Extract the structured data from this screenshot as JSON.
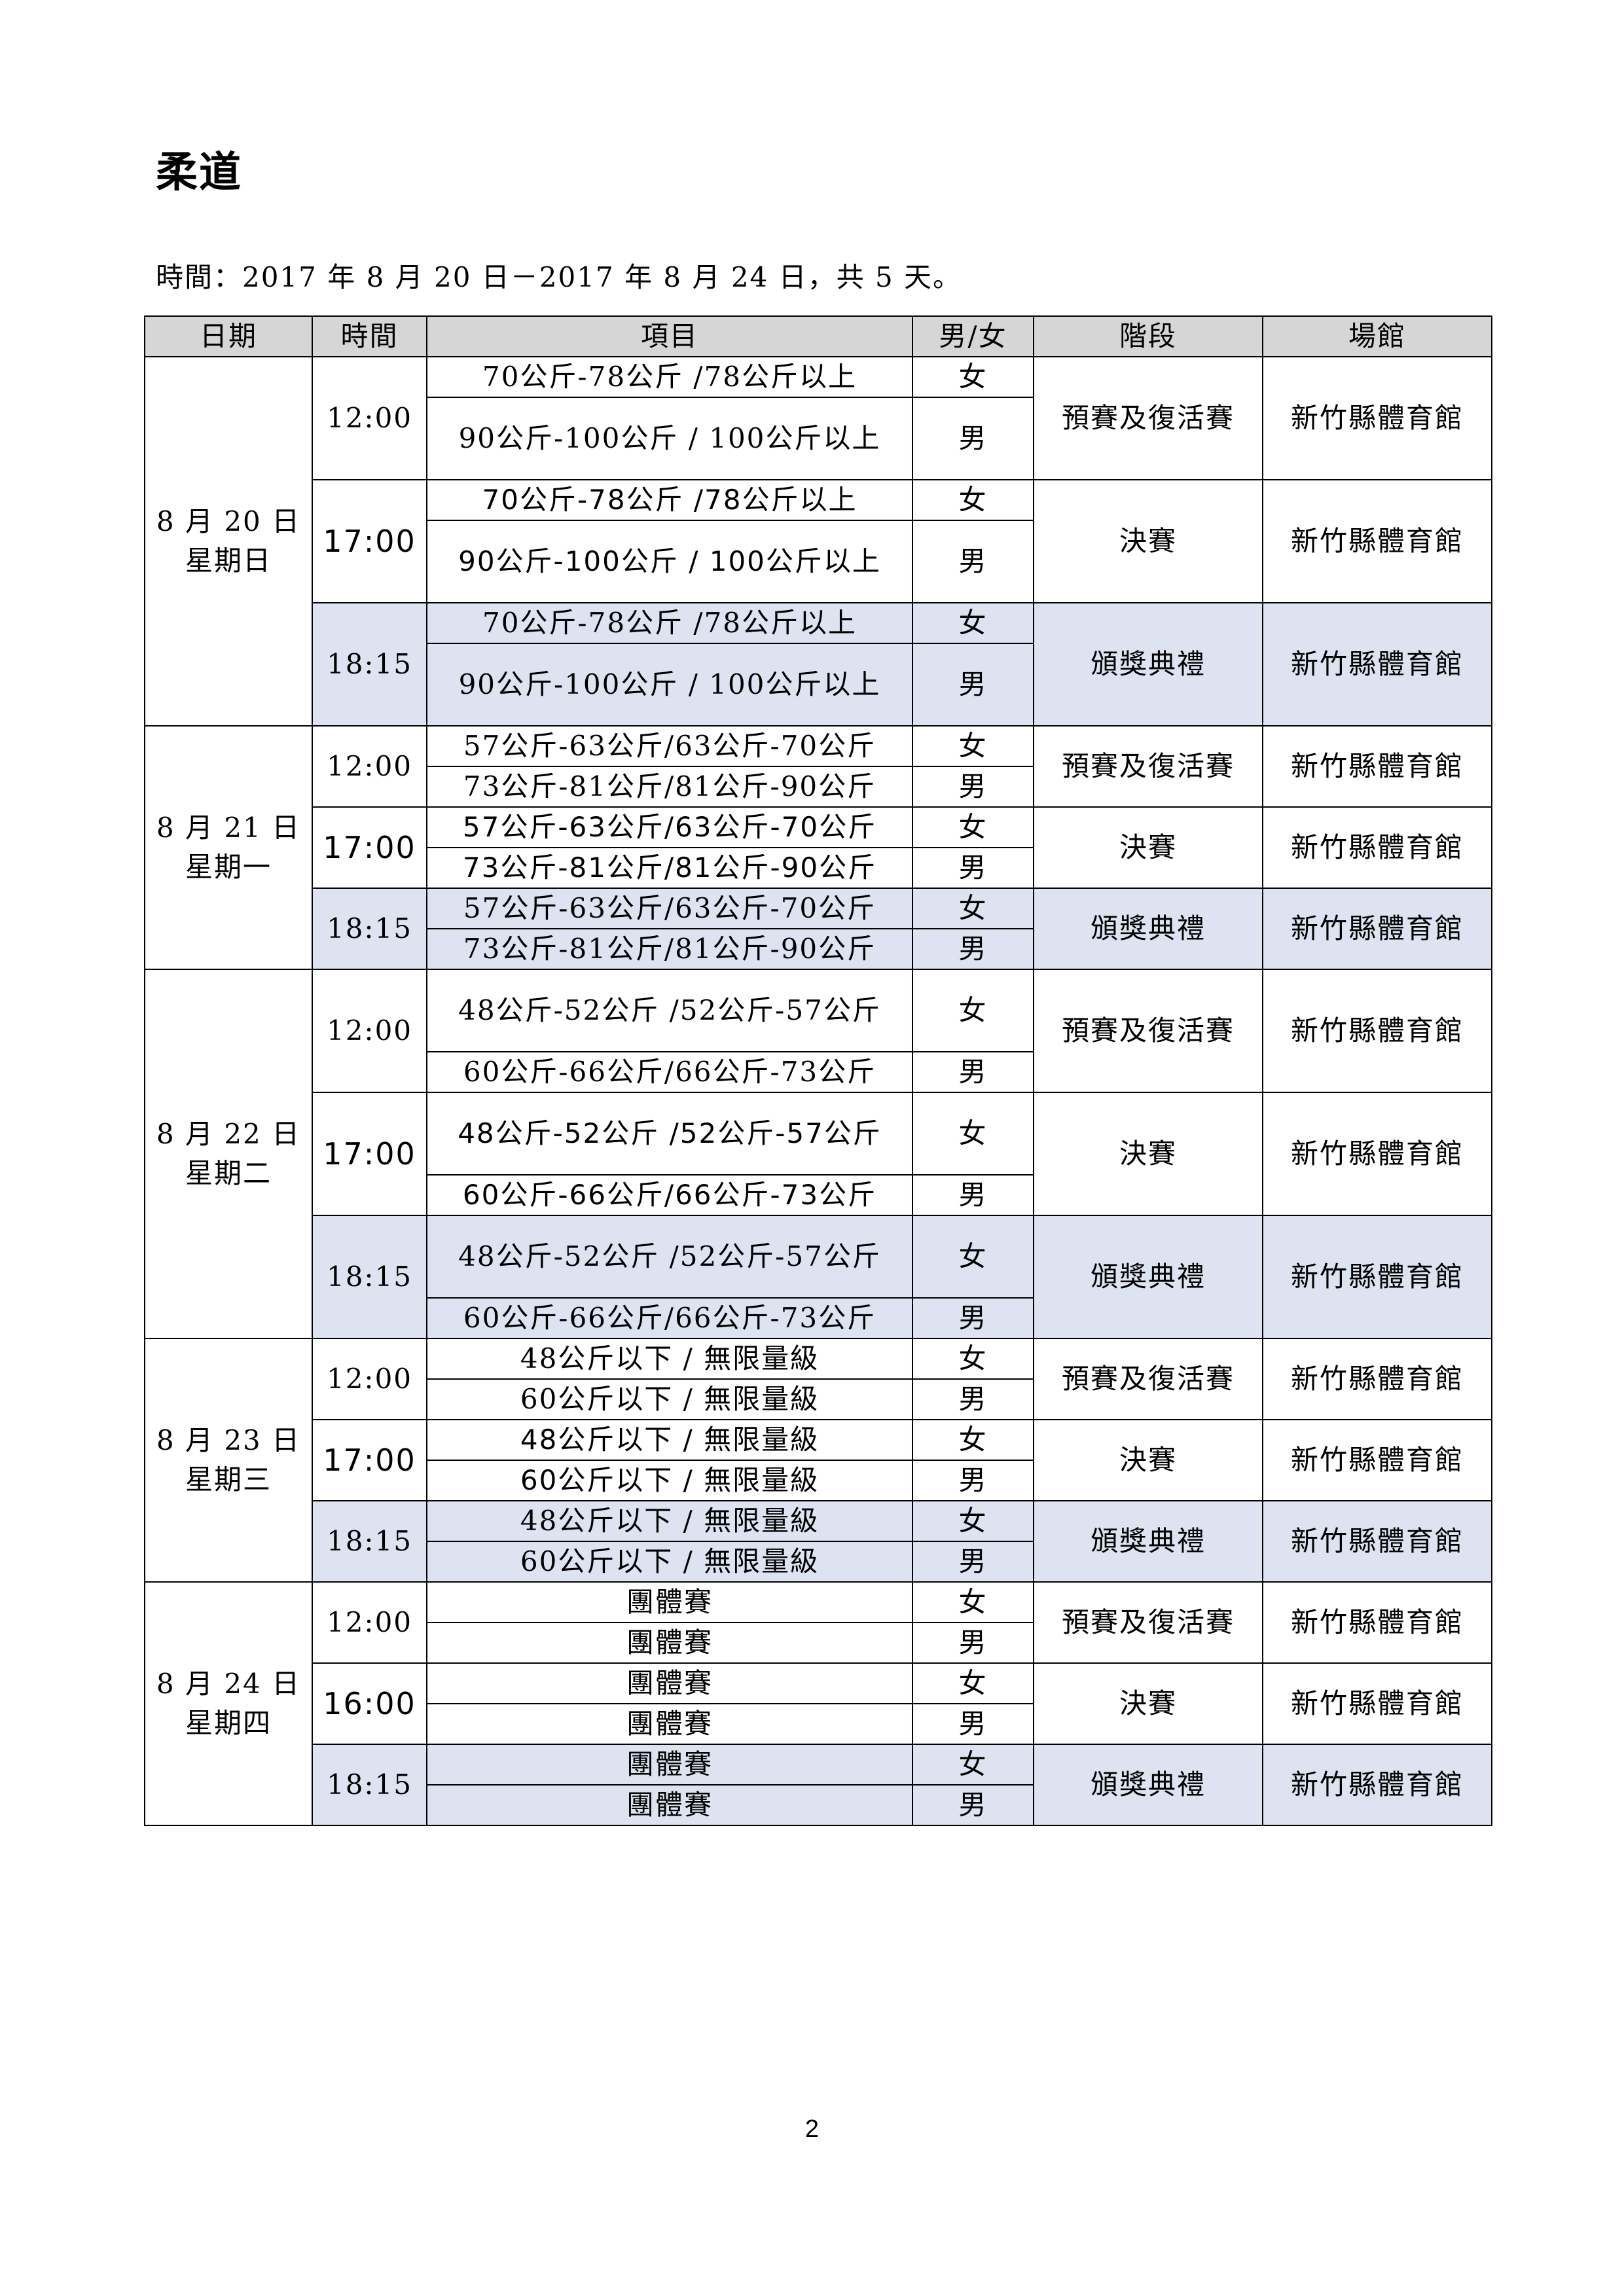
{
  "title": "柔道",
  "subtitle": "時間：2017 年 8 月 20 日－2017 年 8 月 24 日，共 5 天。",
  "headers": {
    "date": "日期",
    "time": "時間",
    "item": "項目",
    "gender": "男/女",
    "stage": "階段",
    "venue": "場館"
  },
  "days": [
    {
      "date": "8 月 20 日 星期日",
      "sessions": [
        {
          "time": "12:00",
          "stage": "預賽及復活賽",
          "venue": "新竹縣體育館",
          "rows": [
            {
              "item": "70公斤-78公斤 /78公斤以上",
              "gender": "女"
            },
            {
              "item": "90公斤-100公斤 / 100公斤以上",
              "gender": "男"
            }
          ]
        },
        {
          "time": "17:00",
          "stage": "決賽",
          "venue": "新竹縣體育館",
          "rows": [
            {
              "item": "70公斤-78公斤 /78公斤以上",
              "gender": "女"
            },
            {
              "item": "90公斤-100公斤 / 100公斤以上",
              "gender": "男"
            }
          ]
        },
        {
          "time": "18:15",
          "stage": "頒獎典禮",
          "venue": "新竹縣體育館",
          "rows": [
            {
              "item": "70公斤-78公斤 /78公斤以上",
              "gender": "女"
            },
            {
              "item": "90公斤-100公斤 / 100公斤以上",
              "gender": "男"
            }
          ]
        }
      ]
    },
    {
      "date": "8 月 21 日 星期一",
      "sessions": [
        {
          "time": "12:00",
          "stage": "預賽及復活賽",
          "venue": "新竹縣體育館",
          "rows": [
            {
              "item": "57公斤-63公斤/63公斤-70公斤",
              "gender": "女"
            },
            {
              "item": "73公斤-81公斤/81公斤-90公斤",
              "gender": "男"
            }
          ]
        },
        {
          "time": "17:00",
          "stage": "決賽",
          "venue": "新竹縣體育館",
          "rows": [
            {
              "item": "57公斤-63公斤/63公斤-70公斤",
              "gender": "女"
            },
            {
              "item": "73公斤-81公斤/81公斤-90公斤",
              "gender": "男"
            }
          ]
        },
        {
          "time": "18:15",
          "stage": "頒獎典禮",
          "venue": "新竹縣體育館",
          "rows": [
            {
              "item": "57公斤-63公斤/63公斤-70公斤",
              "gender": "女"
            },
            {
              "item": "73公斤-81公斤/81公斤-90公斤",
              "gender": "男"
            }
          ]
        }
      ]
    },
    {
      "date": "8 月 22 日星期二",
      "sessions": [
        {
          "time": "12:00",
          "stage": "預賽及復活賽",
          "venue": "新竹縣體育館",
          "rows": [
            {
              "item": "48公斤-52公斤 /52公斤-57公斤",
              "gender": "女"
            },
            {
              "item": "60公斤-66公斤/66公斤-73公斤",
              "gender": "男"
            }
          ]
        },
        {
          "time": "17:00",
          "stage": "決賽",
          "venue": "新竹縣體育館",
          "rows": [
            {
              "item": "48公斤-52公斤 /52公斤-57公斤",
              "gender": "女"
            },
            {
              "item": "60公斤-66公斤/66公斤-73公斤",
              "gender": "男"
            }
          ]
        },
        {
          "time": "18:15",
          "stage": "頒獎典禮",
          "venue": "新竹縣體育館",
          "rows": [
            {
              "item": "48公斤-52公斤 /52公斤-57公斤",
              "gender": "女"
            },
            {
              "item": "60公斤-66公斤/66公斤-73公斤",
              "gender": "男"
            }
          ]
        }
      ]
    },
    {
      "date": "8 月 23 日 星期三",
      "sessions": [
        {
          "time": "12:00",
          "stage": "預賽及復活賽",
          "venue": "新竹縣體育館",
          "rows": [
            {
              "item": "48公斤以下 / 無限量級",
              "gender": "女"
            },
            {
              "item": "60公斤以下 / 無限量級",
              "gender": "男"
            }
          ]
        },
        {
          "time": "17:00",
          "stage": "決賽",
          "venue": "新竹縣體育館",
          "rows": [
            {
              "item": "48公斤以下 / 無限量級",
              "gender": "女"
            },
            {
              "item": "60公斤以下 / 無限量級",
              "gender": "男"
            }
          ]
        },
        {
          "time": "18:15",
          "stage": "頒獎典禮",
          "venue": "新竹縣體育館",
          "rows": [
            {
              "item": "48公斤以下 / 無限量級",
              "gender": "女"
            },
            {
              "item": "60公斤以下 / 無限量級",
              "gender": "男"
            }
          ]
        }
      ]
    },
    {
      "date": "8 月 24 日星期四",
      "sessions": [
        {
          "time": "12:00",
          "stage": "預賽及復活賽",
          "venue": "新竹縣體育館",
          "rows": [
            {
              "item": "團體賽",
              "gender": "女"
            },
            {
              "item": "團體賽",
              "gender": "男"
            }
          ]
        },
        {
          "time": "16:00",
          "stage": "決賽",
          "venue": "新竹縣體育館",
          "rows": [
            {
              "item": "團體賽",
              "gender": "女"
            },
            {
              "item": "團體賽",
              "gender": "男"
            }
          ]
        },
        {
          "time": "18:15",
          "stage": "頒獎典禮",
          "venue": "新竹縣體育館",
          "rows": [
            {
              "item": "團體賽",
              "gender": "女"
            },
            {
              "item": "團體賽",
              "gender": "男"
            }
          ]
        }
      ]
    }
  ],
  "page_number": "2"
}
